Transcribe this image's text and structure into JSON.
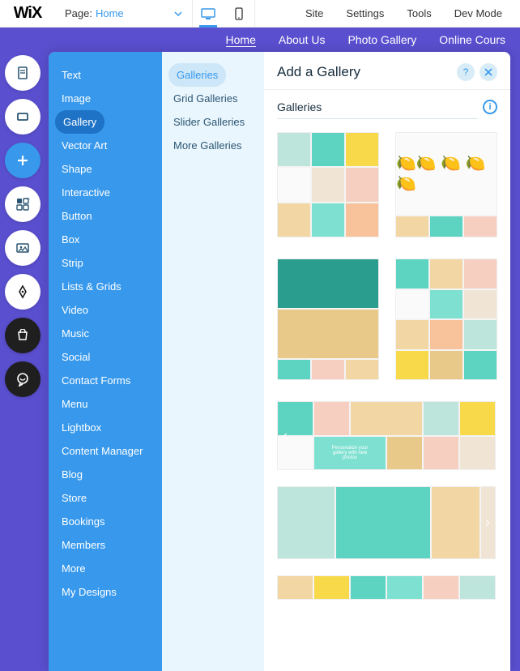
{
  "topbar": {
    "logo": "WiX",
    "page_label": "Page:",
    "page_name": "Home",
    "menu": [
      "Site",
      "Settings",
      "Tools",
      "Dev Mode"
    ]
  },
  "sitenav": {
    "items": [
      "Home",
      "About Us",
      "Photo Gallery",
      "Online Cours"
    ],
    "active": 0
  },
  "leftrail": {
    "icons": [
      "page-icon",
      "section-icon",
      "add-icon",
      "apps-icon",
      "media-icon",
      "pen-icon",
      "store-icon",
      "chat-icon"
    ]
  },
  "add_panel": {
    "title": "Add a Gallery",
    "categories": [
      "Text",
      "Image",
      "Gallery",
      "Vector Art",
      "Shape",
      "Interactive",
      "Button",
      "Box",
      "Strip",
      "Lists & Grids",
      "Video",
      "Music",
      "Social",
      "Contact Forms",
      "Menu",
      "Lightbox",
      "Content Manager",
      "Blog",
      "Store",
      "Bookings",
      "Members",
      "More",
      "My Designs"
    ],
    "selected_category": 2,
    "subcategories": [
      "Galleries",
      "Grid Galleries",
      "Slider Galleries",
      "More Galleries"
    ],
    "selected_sub": 0,
    "section_label": "Galleries"
  }
}
